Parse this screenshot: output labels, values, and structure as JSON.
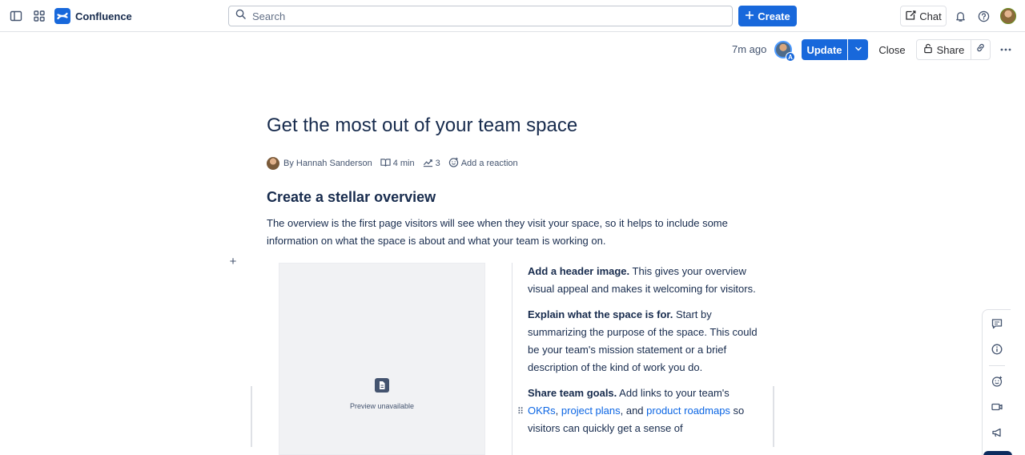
{
  "topnav": {
    "app_name": "Confluence",
    "search_placeholder": "Search",
    "create_label": "Create",
    "chat_label": "Chat",
    "icons": [
      "sidebar-toggle-icon",
      "app-switcher-icon",
      "confluence-logo-icon",
      "search-icon",
      "plus-icon",
      "chat-icon",
      "bell-icon",
      "help-icon"
    ]
  },
  "toolbar": {
    "last_saved": "7m ago",
    "editor_badge": "A",
    "update_label": "Update",
    "close_label": "Close",
    "share_label": "Share"
  },
  "page": {
    "title": "Get the most out of your team space",
    "byline": {
      "author": "By Hannah Sanderson",
      "read_time": "4 min",
      "views": "3",
      "reaction": "Add a reaction"
    },
    "heading": "Create a stellar overview",
    "intro": "The overview is the first page visitors will see when they visit your space, so it helps to include some information on what the space is about and what your team is working on.",
    "preview": {
      "text": "Preview unavailable"
    },
    "tips": [
      {
        "title": "Add a header image.",
        "body": " This gives your overview visual appeal and makes it welcoming for visitors."
      },
      {
        "title": "Explain what the space is for.",
        "body": " Start by summarizing the purpose of the space. This could be your team's mission statement or a brief description of the kind of work you do."
      },
      {
        "title": "Share team goals.",
        "body_pre": " Add links to your team's ",
        "link1": "OKRs",
        "sep1": ", ",
        "link2": "project plans",
        "sep2": ", and ",
        "link3": "product roadmaps",
        "body_post": " so visitors can quickly get a sense of"
      }
    ]
  },
  "rail": {
    "icons": [
      "comment-icon",
      "info-icon",
      "emoji-icon",
      "video-icon",
      "megaphone-icon"
    ]
  },
  "colors": {
    "brand": "#1868db",
    "link": "#0c66e4",
    "text": "#172b4d"
  }
}
